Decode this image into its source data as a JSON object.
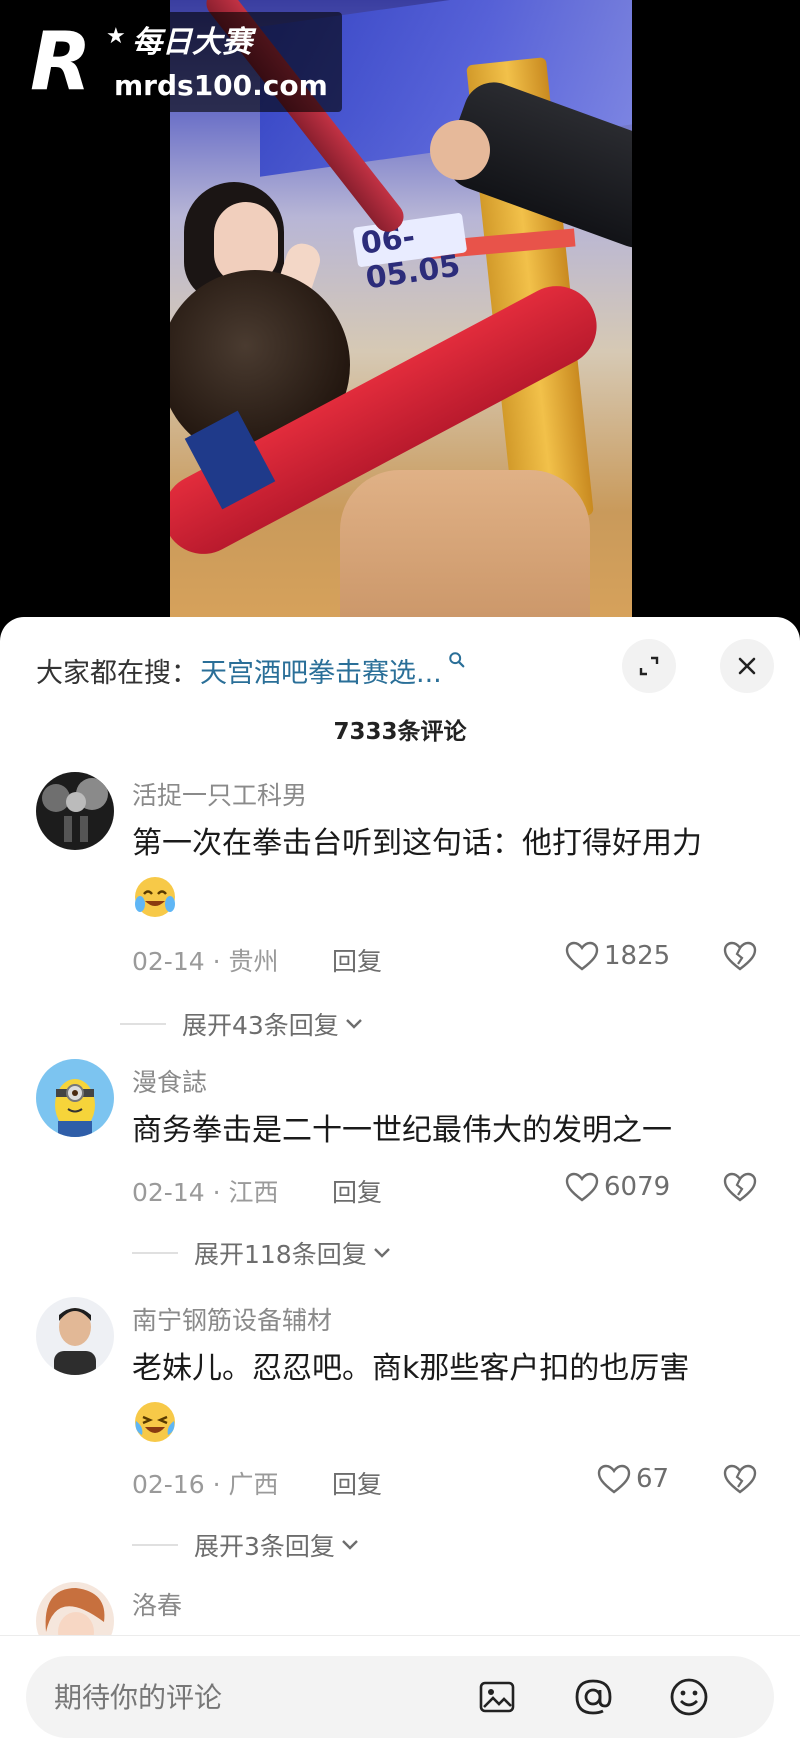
{
  "watermark": {
    "brand_cn": "每日大赛",
    "url": "mrds100.com"
  },
  "video": {
    "screen_text": "06-05.05"
  },
  "sheet": {
    "search_prefix": "大家都在搜：",
    "search_term": "天宫酒吧拳击赛选...",
    "comment_count": "7333条评论"
  },
  "comments": [
    {
      "user": "活捉一只工科男",
      "text": "第一次在拳击台听到这句话：他打得好用力",
      "emoji": "laughing-tears-emoji",
      "date_location": "02-14 · 贵州",
      "reply_label": "回复",
      "likes": "1825",
      "expand_label": "展开43条回复"
    },
    {
      "user": "漫食誌",
      "text": "商务拳击是二十一世纪最伟大的发明之一",
      "date_location": "02-14 · 江西",
      "reply_label": "回复",
      "likes": "6079",
      "expand_label": "展开118条回复"
    },
    {
      "user": "南宁钢筋设备辅材",
      "text": "老妹儿。忍忍吧。商k那些客户扣的也厉害",
      "emoji": "crying-laughing-emoji",
      "date_location": "02-16 · 广西",
      "reply_label": "回复",
      "likes": "67",
      "expand_label": "展开3条回复"
    },
    {
      "user": "洛春"
    }
  ],
  "input": {
    "placeholder": "期待你的评论"
  },
  "colors": {
    "search_term": "#2a6f98",
    "emoji_yellow": "#f7c948"
  }
}
